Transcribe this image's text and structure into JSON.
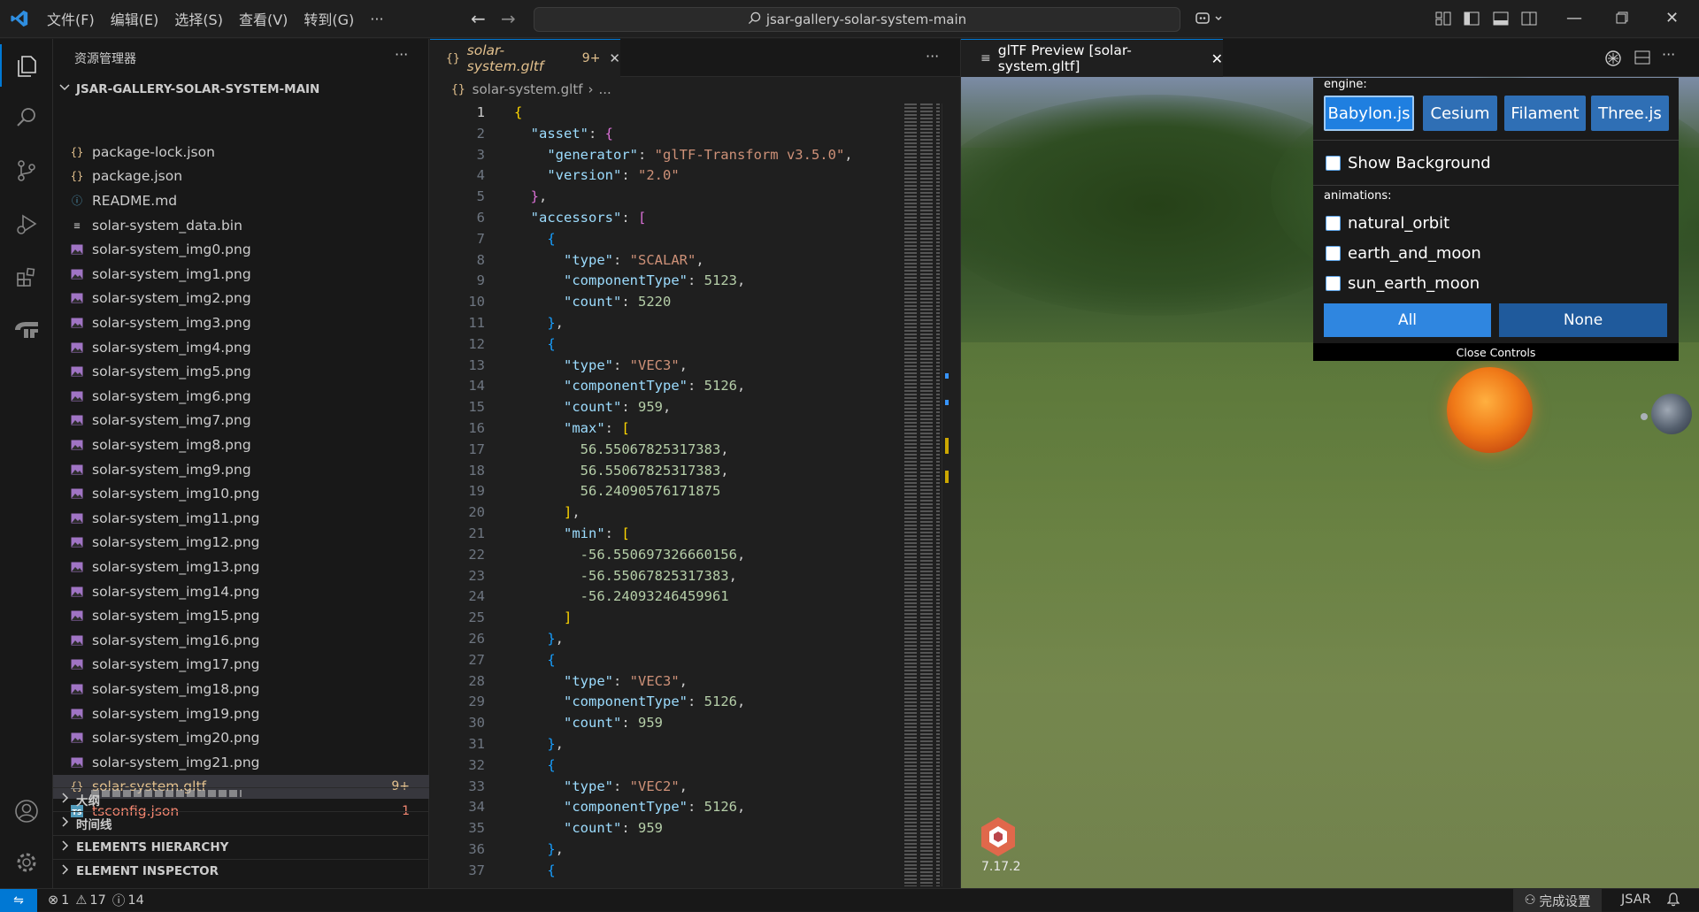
{
  "titlebar": {
    "menus": [
      "文件(F)",
      "编辑(E)",
      "选择(S)",
      "查看(V)",
      "转到(G)",
      "···"
    ],
    "search_text": "jsar-gallery-solar-system-main"
  },
  "sidebar": {
    "title": "资源管理器",
    "more": "···",
    "root": "JSAR-GALLERY-SOLAR-SYSTEM-MAIN",
    "files": [
      {
        "name": "package-lock.json",
        "icon": "{}",
        "badge": ""
      },
      {
        "name": "package.json",
        "icon": "{}",
        "badge": ""
      },
      {
        "name": "README.md",
        "icon": "ⓘ",
        "badge": ""
      },
      {
        "name": "solar-system_data.bin",
        "icon": "≡",
        "badge": ""
      },
      {
        "name": "solar-system_img0.png",
        "icon": "img",
        "badge": ""
      },
      {
        "name": "solar-system_img1.png",
        "icon": "img",
        "badge": ""
      },
      {
        "name": "solar-system_img2.png",
        "icon": "img",
        "badge": ""
      },
      {
        "name": "solar-system_img3.png",
        "icon": "img",
        "badge": ""
      },
      {
        "name": "solar-system_img4.png",
        "icon": "img",
        "badge": ""
      },
      {
        "name": "solar-system_img5.png",
        "icon": "img",
        "badge": ""
      },
      {
        "name": "solar-system_img6.png",
        "icon": "img",
        "badge": ""
      },
      {
        "name": "solar-system_img7.png",
        "icon": "img",
        "badge": ""
      },
      {
        "name": "solar-system_img8.png",
        "icon": "img",
        "badge": ""
      },
      {
        "name": "solar-system_img9.png",
        "icon": "img",
        "badge": ""
      },
      {
        "name": "solar-system_img10.png",
        "icon": "img",
        "badge": ""
      },
      {
        "name": "solar-system_img11.png",
        "icon": "img",
        "badge": ""
      },
      {
        "name": "solar-system_img12.png",
        "icon": "img",
        "badge": ""
      },
      {
        "name": "solar-system_img13.png",
        "icon": "img",
        "badge": ""
      },
      {
        "name": "solar-system_img14.png",
        "icon": "img",
        "badge": ""
      },
      {
        "name": "solar-system_img15.png",
        "icon": "img",
        "badge": ""
      },
      {
        "name": "solar-system_img16.png",
        "icon": "img",
        "badge": ""
      },
      {
        "name": "solar-system_img17.png",
        "icon": "img",
        "badge": ""
      },
      {
        "name": "solar-system_img18.png",
        "icon": "img",
        "badge": ""
      },
      {
        "name": "solar-system_img19.png",
        "icon": "img",
        "badge": ""
      },
      {
        "name": "solar-system_img20.png",
        "icon": "img",
        "badge": ""
      },
      {
        "name": "solar-system_img21.png",
        "icon": "img",
        "badge": ""
      },
      {
        "name": "solar-system.gltf",
        "icon": "{}",
        "badge": "9+"
      },
      {
        "name": "tsconfig.json",
        "icon": "TS",
        "badge": "1"
      }
    ],
    "sections": [
      "大纲",
      "时间线",
      "ELEMENTS HIERARCHY",
      "ELEMENT INSPECTOR"
    ]
  },
  "editor": {
    "tab_label": "solar-system.gltf",
    "tab_badge": "9+",
    "more": "···",
    "breadcrumb_file": "solar-system.gltf",
    "breadcrumb_rest": "...",
    "lines": [
      [
        [
          "b1",
          "{"
        ]
      ],
      [
        [
          "p",
          "  "
        ],
        [
          "k",
          "\"asset\""
        ],
        [
          "p",
          ": "
        ],
        [
          "b2",
          "{"
        ]
      ],
      [
        [
          "p",
          "    "
        ],
        [
          "k",
          "\"generator\""
        ],
        [
          "p",
          ": "
        ],
        [
          "s",
          "\"glTF-Transform v3.5.0\""
        ],
        [
          "p",
          ","
        ]
      ],
      [
        [
          "p",
          "    "
        ],
        [
          "k",
          "\"version\""
        ],
        [
          "p",
          ": "
        ],
        [
          "s",
          "\"2.0\""
        ]
      ],
      [
        [
          "p",
          "  "
        ],
        [
          "b2",
          "}"
        ],
        [
          "p",
          ","
        ]
      ],
      [
        [
          "p",
          "  "
        ],
        [
          "k",
          "\"accessors\""
        ],
        [
          "p",
          ": "
        ],
        [
          "b2",
          "["
        ]
      ],
      [
        [
          "p",
          "    "
        ],
        [
          "b3",
          "{"
        ]
      ],
      [
        [
          "p",
          "      "
        ],
        [
          "k",
          "\"type\""
        ],
        [
          "p",
          ": "
        ],
        [
          "s",
          "\"SCALAR\""
        ],
        [
          "p",
          ","
        ]
      ],
      [
        [
          "p",
          "      "
        ],
        [
          "k",
          "\"componentType\""
        ],
        [
          "p",
          ": "
        ],
        [
          "n",
          "5123"
        ],
        [
          "p",
          ","
        ]
      ],
      [
        [
          "p",
          "      "
        ],
        [
          "k",
          "\"count\""
        ],
        [
          "p",
          ": "
        ],
        [
          "n",
          "5220"
        ]
      ],
      [
        [
          "p",
          "    "
        ],
        [
          "b3",
          "}"
        ],
        [
          "p",
          ","
        ]
      ],
      [
        [
          "p",
          "    "
        ],
        [
          "b3",
          "{"
        ]
      ],
      [
        [
          "p",
          "      "
        ],
        [
          "k",
          "\"type\""
        ],
        [
          "p",
          ": "
        ],
        [
          "s",
          "\"VEC3\""
        ],
        [
          "p",
          ","
        ]
      ],
      [
        [
          "p",
          "      "
        ],
        [
          "k",
          "\"componentType\""
        ],
        [
          "p",
          ": "
        ],
        [
          "n",
          "5126"
        ],
        [
          "p",
          ","
        ]
      ],
      [
        [
          "p",
          "      "
        ],
        [
          "k",
          "\"count\""
        ],
        [
          "p",
          ": "
        ],
        [
          "n",
          "959"
        ],
        [
          "p",
          ","
        ]
      ],
      [
        [
          "p",
          "      "
        ],
        [
          "k",
          "\"max\""
        ],
        [
          "p",
          ": "
        ],
        [
          "b1",
          "["
        ]
      ],
      [
        [
          "p",
          "        "
        ],
        [
          "n",
          "56.55067825317383"
        ],
        [
          "p",
          ","
        ]
      ],
      [
        [
          "p",
          "        "
        ],
        [
          "n",
          "56.55067825317383"
        ],
        [
          "p",
          ","
        ]
      ],
      [
        [
          "p",
          "        "
        ],
        [
          "n",
          "56.24090576171875"
        ]
      ],
      [
        [
          "p",
          "      "
        ],
        [
          "b1",
          "]"
        ],
        [
          "p",
          ","
        ]
      ],
      [
        [
          "p",
          "      "
        ],
        [
          "k",
          "\"min\""
        ],
        [
          "p",
          ": "
        ],
        [
          "b1",
          "["
        ]
      ],
      [
        [
          "p",
          "        "
        ],
        [
          "n",
          "-56.550697326660156"
        ],
        [
          "p",
          ","
        ]
      ],
      [
        [
          "p",
          "        "
        ],
        [
          "n",
          "-56.55067825317383"
        ],
        [
          "p",
          ","
        ]
      ],
      [
        [
          "p",
          "        "
        ],
        [
          "n",
          "-56.24093246459961"
        ]
      ],
      [
        [
          "p",
          "      "
        ],
        [
          "b1",
          "]"
        ]
      ],
      [
        [
          "p",
          "    "
        ],
        [
          "b3",
          "}"
        ],
        [
          "p",
          ","
        ]
      ],
      [
        [
          "p",
          "    "
        ],
        [
          "b3",
          "{"
        ]
      ],
      [
        [
          "p",
          "      "
        ],
        [
          "k",
          "\"type\""
        ],
        [
          "p",
          ": "
        ],
        [
          "s",
          "\"VEC3\""
        ],
        [
          "p",
          ","
        ]
      ],
      [
        [
          "p",
          "      "
        ],
        [
          "k",
          "\"componentType\""
        ],
        [
          "p",
          ": "
        ],
        [
          "n",
          "5126"
        ],
        [
          "p",
          ","
        ]
      ],
      [
        [
          "p",
          "      "
        ],
        [
          "k",
          "\"count\""
        ],
        [
          "p",
          ": "
        ],
        [
          "n",
          "959"
        ]
      ],
      [
        [
          "p",
          "    "
        ],
        [
          "b3",
          "}"
        ],
        [
          "p",
          ","
        ]
      ],
      [
        [
          "p",
          "    "
        ],
        [
          "b3",
          "{"
        ]
      ],
      [
        [
          "p",
          "      "
        ],
        [
          "k",
          "\"type\""
        ],
        [
          "p",
          ": "
        ],
        [
          "s",
          "\"VEC2\""
        ],
        [
          "p",
          ","
        ]
      ],
      [
        [
          "p",
          "      "
        ],
        [
          "k",
          "\"componentType\""
        ],
        [
          "p",
          ": "
        ],
        [
          "n",
          "5126"
        ],
        [
          "p",
          ","
        ]
      ],
      [
        [
          "p",
          "      "
        ],
        [
          "k",
          "\"count\""
        ],
        [
          "p",
          ": "
        ],
        [
          "n",
          "959"
        ]
      ],
      [
        [
          "p",
          "    "
        ],
        [
          "b3",
          "}"
        ],
        [
          "p",
          ","
        ]
      ],
      [
        [
          "p",
          "    "
        ],
        [
          "b3",
          "{"
        ]
      ]
    ]
  },
  "preview": {
    "tab_label": "glTF Preview [solar-system.gltf]",
    "engine_label": "engine:",
    "engines": [
      "Babylon.js",
      "Cesium",
      "Filament",
      "Three.js"
    ],
    "show_background": "Show Background",
    "animations_label": "animations:",
    "animations": [
      "natural_orbit",
      "earth_and_moon",
      "sun_earth_moon"
    ],
    "all_button": "All",
    "none_button": "None",
    "close_controls": "Close Controls",
    "version": "7.17.2",
    "colors": {
      "active_engine": "#1f7fe0",
      "engine": "#2f6fb5",
      "all": "#2f86e0",
      "none": "#1f5a9c"
    }
  },
  "statusbar": {
    "errors": "1",
    "warnings": "17",
    "infos": "14",
    "settings_sync": "完成设置",
    "jsar": "JSAR"
  }
}
